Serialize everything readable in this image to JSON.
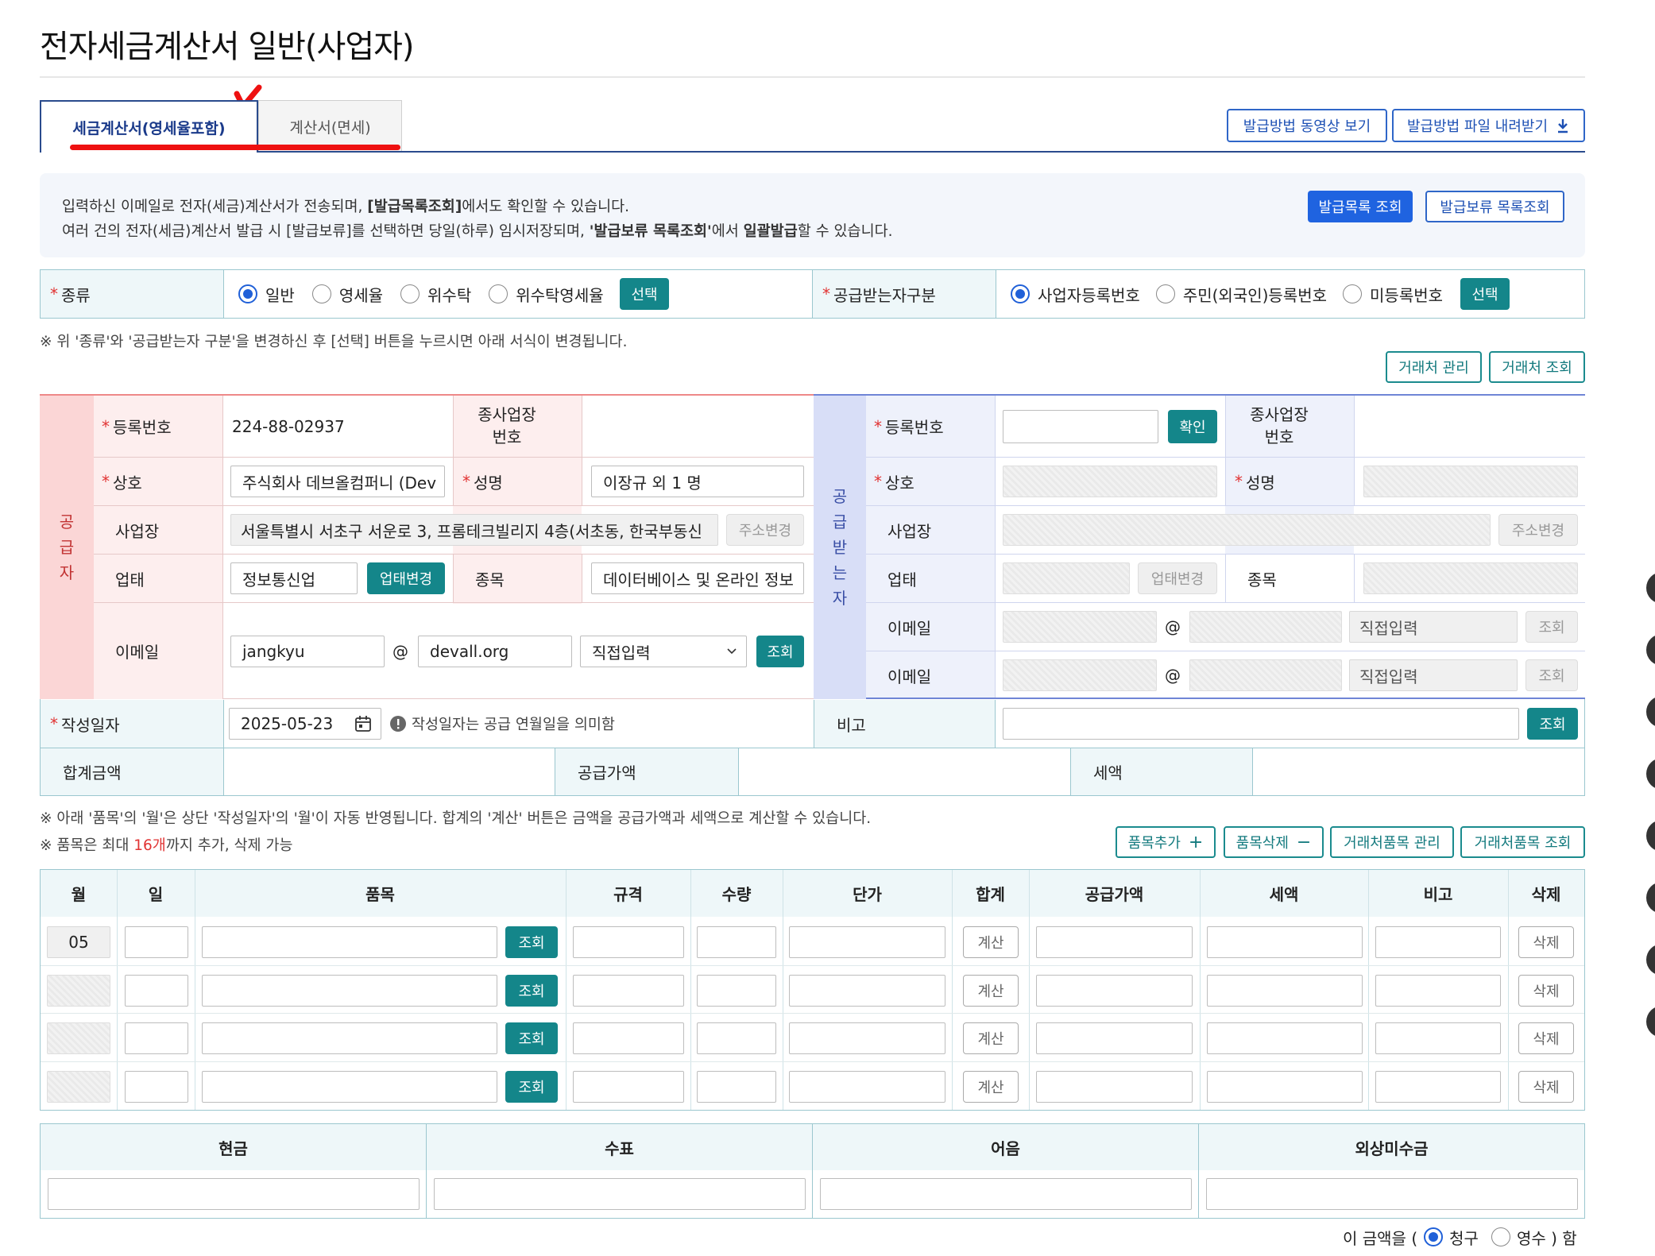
{
  "page_title": "전자세금계산서 일반(사업자)",
  "tabs": [
    {
      "label": "세금계산서(영세율포함)",
      "active": true
    },
    {
      "label": "계산서(면세)",
      "active": false
    }
  ],
  "header_buttons": {
    "video": "발급방법 동영상 보기",
    "download": "발급방법 파일 내려받기"
  },
  "info": {
    "line1_a": "입력하신 이메일로 전자(세금)계산서가 전송되며, ",
    "line1_b": "[발급목록조회]",
    "line1_c": "에서도 확인할 수 있습니다.",
    "line2_a": "여러 건의 전자(세금)계산서 발급 시 [발급보류]를 선택하면 당일(하루) 임시저장되며, ",
    "line2_b": "'발급보류 목록조회'",
    "line2_c": "에서 ",
    "line2_d": "일괄발급",
    "line2_e": "할 수 있습니다.",
    "btn_list": "발급목록 조회",
    "btn_hold": "발급보류 목록조회"
  },
  "kind": {
    "label": "종류",
    "options": [
      "일반",
      "영세율",
      "위수탁",
      "위수탁영세율"
    ],
    "selected": "일반",
    "select_btn": "선택"
  },
  "receiver_type": {
    "label": "공급받는자구분",
    "options": [
      "사업자등록번호",
      "주민(외국인)등록번호",
      "미등록번호"
    ],
    "selected": "사업자등록번호",
    "select_btn": "선택"
  },
  "note_kind": "※ 위 '종류'와 '공급받는자 구분'을 변경하신 후 [선택] 버튼을 누르시면 아래 서식이 변경됩니다.",
  "partner_buttons": {
    "manage": "거래처 관리",
    "lookup": "거래처 조회"
  },
  "supplier": {
    "side_label": [
      "공",
      "급",
      "자"
    ],
    "reg_no_label": "등록번호",
    "reg_no": "224-88-02937",
    "branch_label_1": "종사업장",
    "branch_label_2": "번호",
    "company_label": "상호",
    "company": "주식회사 데브올컴퍼니 (Dev",
    "name_label": "성명",
    "name": "이장규 외 1 명",
    "address_label": "사업장",
    "address": "서울특별시 서초구 서운로 3, 프롬테크빌리지 4층(서초동, 한국부동신",
    "address_btn": "주소변경",
    "biz_type_label": "업태",
    "biz_type": "정보통신업",
    "biz_type_btn": "업태변경",
    "item_label": "종목",
    "item": "데이터베이스 및 온라인 정보",
    "email_label": "이메일",
    "email_id": "jangkyu",
    "at": "@",
    "email_domain": "devall.org",
    "email_select": "직접입력",
    "email_btn": "조회"
  },
  "receiver": {
    "side_label": [
      "공",
      "급",
      "받",
      "는",
      "자"
    ],
    "reg_no_label": "등록번호",
    "confirm_btn": "확인",
    "branch_label_1": "종사업장",
    "branch_label_2": "번호",
    "company_label": "상호",
    "name_label": "성명",
    "address_label": "사업장",
    "address_btn": "주소변경",
    "biz_type_label": "업태",
    "biz_type_btn": "업태변경",
    "item_label": "종목",
    "email_label": "이메일",
    "email_label2": "이메일",
    "at": "@",
    "email_select": "직접입력",
    "email_btn": "조회"
  },
  "write_date": {
    "label": "작성일자",
    "value": "2025-05-23",
    "hint": "작성일자는 공급 연월일을 의미함"
  },
  "remark": {
    "label": "비고",
    "btn": "조회"
  },
  "totals": {
    "total_label": "합계금액",
    "supply_label": "공급가액",
    "tax_label": "세액"
  },
  "note_items_1": "※ 아래 '품목'의 '월'은 상단 '작성일자'의 '월'이 자동 반영됩니다. 합계의 '계산' 버튼은 금액을 공급가액과 세액으로 계산할 수 있습니다.",
  "note_items_2a": "※ 품목은 최대 ",
  "note_items_2b": "16개",
  "note_items_2c": "까지 추가, 삭제 가능",
  "item_buttons": {
    "add": "품목추가",
    "remove": "품목삭제",
    "manage": "거래처품목 관리",
    "lookup": "거래처품목 조회"
  },
  "items_table": {
    "headers": [
      "월",
      "일",
      "품목",
      "규격",
      "수량",
      "단가",
      "합계",
      "공급가액",
      "세액",
      "비고",
      "삭제"
    ],
    "rows": [
      {
        "month": "05",
        "lookup": "조회",
        "calc": "계산",
        "delete": "삭제"
      },
      {
        "month": "",
        "lookup": "조회",
        "calc": "계산",
        "delete": "삭제"
      },
      {
        "month": "",
        "lookup": "조회",
        "calc": "계산",
        "delete": "삭제"
      },
      {
        "month": "",
        "lookup": "조회",
        "calc": "계산",
        "delete": "삭제"
      }
    ]
  },
  "payment": {
    "headers": [
      "현금",
      "수표",
      "어음",
      "외상미수금"
    ]
  },
  "receipt": {
    "prefix": "이 금액을 (",
    "opt1": "청구",
    "opt2": "영수 ) 함",
    "selected": "청구"
  },
  "colors": {
    "teal": "#14868a",
    "blue": "#1f63e0",
    "supplier_bg": "#fbd6d6",
    "receiver_bg": "#d8def7",
    "red_mark": "#ee1111"
  }
}
